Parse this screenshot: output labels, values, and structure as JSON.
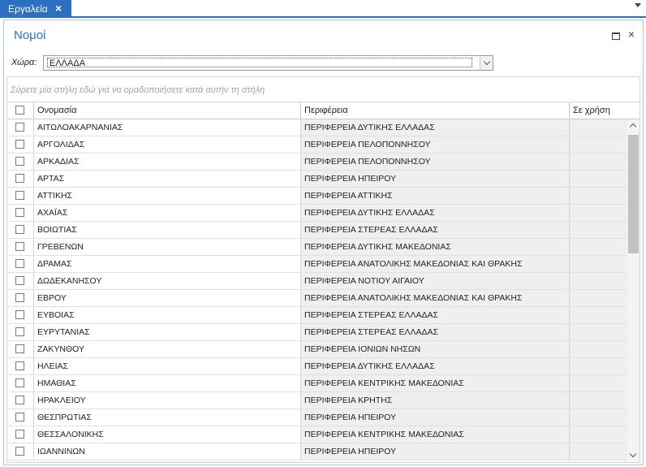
{
  "tab": {
    "label": "Εργαλεία"
  },
  "panel": {
    "title": "Νομοί"
  },
  "filter": {
    "label": "Χώρα:",
    "country_value": "ΕΛΛΑΔΑ"
  },
  "group_hint": "Σύρετε μία στήλη εδώ για να ομαδοποιήσετε κατά αυτήν τη στήλη",
  "columns": {
    "name": "Ονομασία",
    "region": "Περιφέρεια",
    "in_use": "Σε χρήση"
  },
  "rows": [
    {
      "name": "ΑΙΤΩΛΟΑΚΑΡΝΑΝΙΑΣ",
      "region": "ΠΕΡΙΦΕΡΕΙΑ ΔΥΤΙΚΗΣ ΕΛΛΑΔΑΣ"
    },
    {
      "name": "ΑΡΓΟΛΙΔΑΣ",
      "region": "ΠΕΡΙΦΕΡΕΙΑ ΠΕΛΟΠΟΝΝΗΣΟΥ"
    },
    {
      "name": "ΑΡΚΑΔΙΑΣ",
      "region": "ΠΕΡΙΦΕΡΕΙΑ ΠΕΛΟΠΟΝΝΗΣΟΥ"
    },
    {
      "name": "ΑΡΤΑΣ",
      "region": "ΠΕΡΙΦΕΡΕΙΑ ΗΠΕΙΡΟΥ"
    },
    {
      "name": "ΑΤΤΙΚΗΣ",
      "region": "ΠΕΡΙΦΕΡΕΙΑ ΑΤΤΙΚΗΣ"
    },
    {
      "name": "ΑΧΑΪΑΣ",
      "region": "ΠΕΡΙΦΕΡΕΙΑ ΔΥΤΙΚΗΣ ΕΛΛΑΔΑΣ"
    },
    {
      "name": "ΒΟΙΩΤΙΑΣ",
      "region": "ΠΕΡΙΦΕΡΕΙΑ ΣΤΕΡΕΑΣ ΕΛΛΑΔΑΣ"
    },
    {
      "name": "ΓΡΕΒΕΝΩΝ",
      "region": "ΠΕΡΙΦΕΡΕΙΑ ΔΥΤΙΚΗΣ ΜΑΚΕΔΟΝΙΑΣ"
    },
    {
      "name": "ΔΡΑΜΑΣ",
      "region": "ΠΕΡΙΦΕΡΕΙΑ ΑΝΑΤΟΛΙΚΗΣ ΜΑΚΕΔΟΝΙΑΣ ΚΑΙ ΘΡΑΚΗΣ"
    },
    {
      "name": "ΔΩΔΕΚΑΝΗΣΟΥ",
      "region": "ΠΕΡΙΦΕΡΕΙΑ ΝΟΤΙΟΥ ΑΙΓΑΙΟΥ"
    },
    {
      "name": "ΕΒΡΟΥ",
      "region": "ΠΕΡΙΦΕΡΕΙΑ ΑΝΑΤΟΛΙΚΗΣ ΜΑΚΕΔΟΝΙΑΣ ΚΑΙ ΘΡΑΚΗΣ"
    },
    {
      "name": "ΕΥΒΟΙΑΣ",
      "region": "ΠΕΡΙΦΕΡΕΙΑ ΣΤΕΡΕΑΣ ΕΛΛΑΔΑΣ"
    },
    {
      "name": "ΕΥΡΥΤΑΝΙΑΣ",
      "region": "ΠΕΡΙΦΕΡΕΙΑ ΣΤΕΡΕΑΣ ΕΛΛΑΔΑΣ"
    },
    {
      "name": "ΖΑΚΥΝΘΟΥ",
      "region": "ΠΕΡΙΦΕΡΕΙΑ ΙΟΝΙΩΝ ΝΗΣΩΝ"
    },
    {
      "name": "ΗΛΕΙΑΣ",
      "region": "ΠΕΡΙΦΕΡΕΙΑ ΔΥΤΙΚΗΣ ΕΛΛΑΔΑΣ"
    },
    {
      "name": "ΗΜΑΘΙΑΣ",
      "region": "ΠΕΡΙΦΕΡΕΙΑ ΚΕΝΤΡΙΚΗΣ ΜΑΚΕΔΟΝΙΑΣ"
    },
    {
      "name": "ΗΡΑΚΛΕΙΟΥ",
      "region": "ΠΕΡΙΦΕΡΕΙΑ ΚΡΗΤΗΣ"
    },
    {
      "name": "ΘΕΣΠΡΩΤΙΑΣ",
      "region": "ΠΕΡΙΦΕΡΕΙΑ ΗΠΕΙΡΟΥ"
    },
    {
      "name": "ΘΕΣΣΑΛΟΝΙΚΗΣ",
      "region": "ΠΕΡΙΦΕΡΕΙΑ ΚΕΝΤΡΙΚΗΣ ΜΑΚΕΔΟΝΙΑΣ"
    },
    {
      "name": "ΙΩΑΝΝΙΝΩΝ",
      "region": "ΠΕΡΙΦΕΡΕΙΑ ΗΠΕΙΡΟΥ"
    }
  ],
  "icons": {
    "tab_close": "close-icon",
    "tabbar_menu": "chevron-down-icon",
    "window_maximize": "maximize-icon",
    "window_close": "close-icon",
    "dropdown": "chevron-down-icon",
    "scroll_up": "chevron-up-icon",
    "scroll_down": "chevron-down-icon"
  },
  "colors": {
    "accent": "#2b71c0",
    "title": "#2b71c0",
    "readonly_cell": "#efefef"
  }
}
